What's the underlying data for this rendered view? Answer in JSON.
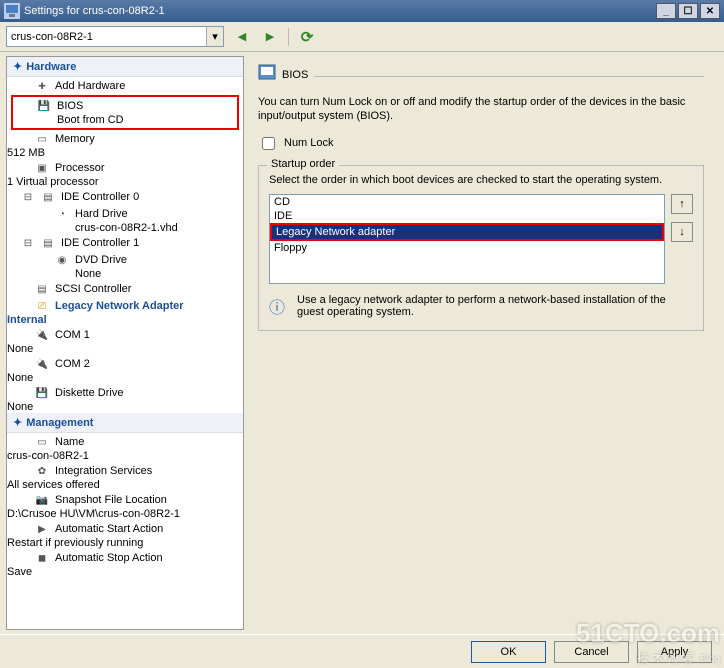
{
  "title": "Settings for crus-con-08R2-1",
  "combo_value": "crus-con-08R2-1",
  "sections": {
    "hardware": "Hardware",
    "management": "Management"
  },
  "tree": {
    "add_hardware": "Add Hardware",
    "bios": "BIOS",
    "bios_sub": "Boot from CD",
    "memory": "Memory",
    "memory_sub": "512 MB",
    "processor": "Processor",
    "processor_sub": "1 Virtual processor",
    "ide0": "IDE Controller 0",
    "hd": "Hard Drive",
    "hd_sub": "crus-con-08R2-1.vhd",
    "ide1": "IDE Controller 1",
    "dvd": "DVD Drive",
    "dvd_sub": "None",
    "scsi": "SCSI Controller",
    "legacy_net": "Legacy Network Adapter",
    "legacy_net_sub": "Internal",
    "com1": "COM 1",
    "com1_sub": "None",
    "com2": "COM 2",
    "com2_sub": "None",
    "diskette": "Diskette Drive",
    "diskette_sub": "None",
    "name": "Name",
    "name_sub": "crus-con-08R2-1",
    "integration": "Integration Services",
    "integration_sub": "All services offered",
    "snapshot": "Snapshot File Location",
    "snapshot_sub": "D:\\Crusoe HU\\VM\\crus-con-08R2-1",
    "autostart": "Automatic Start Action",
    "autostart_sub": "Restart if previously running",
    "autostop": "Automatic Stop Action",
    "autostop_sub": "Save"
  },
  "panel": {
    "title": "BIOS",
    "desc": "You can turn Num Lock on or off and modify the startup order of the devices in the basic input/output system (BIOS).",
    "numlock": "Num Lock",
    "group_title": "Startup order",
    "group_desc": "Select the order in which boot devices are checked to start the operating system.",
    "list": [
      "CD",
      "IDE",
      "Legacy Network adapter",
      "Floppy"
    ],
    "selected_index": 2,
    "info": "Use a legacy network adapter to perform a network-based installation of the guest operating system."
  },
  "buttons": {
    "ok": "OK",
    "cancel": "Cancel",
    "apply": "Apply"
  },
  "watermark": {
    "line1": "51CTO.com",
    "line2": "技术博客",
    "tag": "Blog"
  }
}
